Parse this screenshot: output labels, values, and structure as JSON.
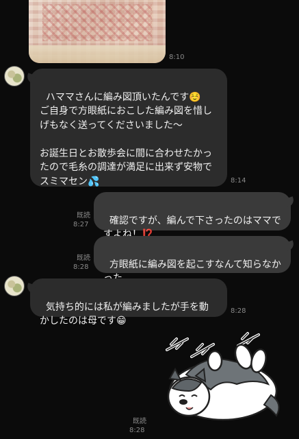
{
  "top_image": {
    "time": "8:10"
  },
  "messages": [
    {
      "side": "in",
      "text": "ハママさんに編み図頂いたんです☺️\nご自身で方眼紙におこした編み図を惜しげもなく送ってくださいました〜\n\nお誕生日とお散歩会に間に合わせたかったので毛糸の調達が満足に出来ず安物でスミマセン💦",
      "time": "8:14"
    },
    {
      "side": "out",
      "text": "確認ですが、編んで下さったのはママですよね！⁉️",
      "read": "既読",
      "time": "8:27"
    },
    {
      "side": "out",
      "text": "方眼紙に編み図を起こすなんて知らなかった",
      "read": "既読",
      "time": "8:28"
    },
    {
      "side": "in",
      "text": "気持ち的には私が編みましたが手を動かしたのは母です😁",
      "time": "8:28"
    }
  ],
  "sticker": {
    "read": "既読",
    "time": "8:28",
    "icon": "husky-rolling-sticker-icon"
  }
}
